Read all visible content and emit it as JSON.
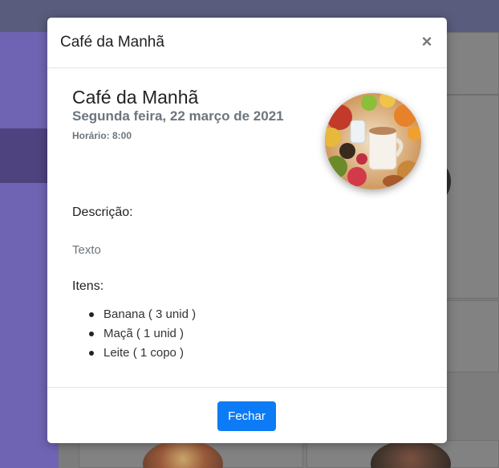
{
  "modal": {
    "title": "Café da Manhã",
    "close_icon": "close-icon",
    "close_glyph": "×"
  },
  "meal": {
    "title": "Café da Manhã",
    "date": "Segunda feira, 22 março de 2021",
    "time": "Horário: 8:00",
    "photo": "breakfast-photo"
  },
  "description": {
    "heading": "Descrição:",
    "text": "Texto"
  },
  "items": {
    "heading": "Itens:",
    "list": [
      {
        "label": "Banana ( 3 unid )"
      },
      {
        "label": "Maçã ( 1 unid )"
      },
      {
        "label": "Leite ( 1 copo )"
      }
    ]
  },
  "footer": {
    "close_button": "Fechar"
  },
  "colors": {
    "primary": "#0d7bf5",
    "muted": "#6c757d",
    "sidebar": "#3f2a96"
  }
}
